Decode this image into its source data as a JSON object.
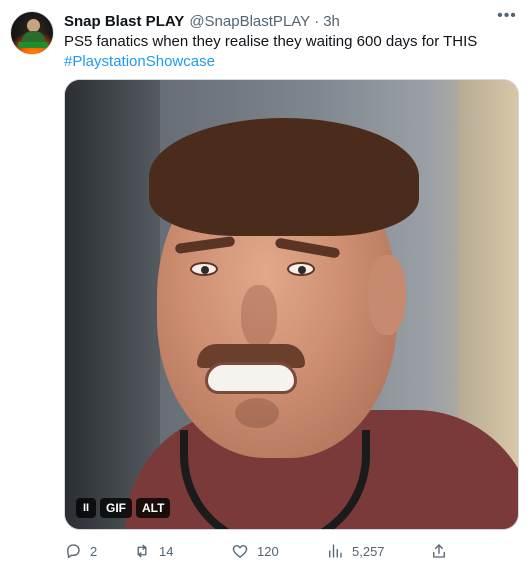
{
  "tweet": {
    "author": {
      "name": "Snap Blast PLAY",
      "handle": "@SnapBlastPLAY",
      "time": "3h"
    },
    "text": "PS5 fanatics when they realise they waiting 600 days for THIS",
    "hashtag": "#PlaystationShowcase",
    "media": {
      "pause_label": "II",
      "gif_label": "GIF",
      "alt_label": "ALT"
    },
    "actions": {
      "replies": "2",
      "reposts": "14",
      "likes": "120",
      "views": "5,257"
    },
    "icons": {
      "more": "more-horizontal-icon",
      "reply": "reply-icon",
      "repost": "repost-icon",
      "like": "heart-icon",
      "views": "views-bar-chart-icon",
      "share": "share-icon"
    },
    "colors": {
      "text": "#0f1419",
      "secondary": "#536471",
      "link": "#1d9bf0",
      "border": "#cfd9de"
    }
  }
}
